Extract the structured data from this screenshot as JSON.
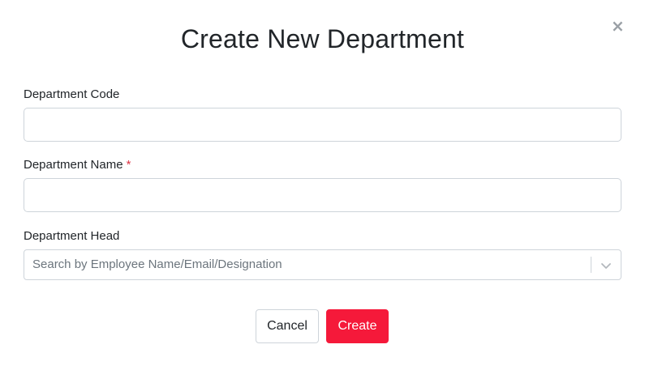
{
  "modal": {
    "title": "Create New Department",
    "close_icon": "close-icon",
    "close_symbol": "×"
  },
  "form": {
    "department_code": {
      "label": "Department Code",
      "value": "",
      "placeholder": ""
    },
    "department_name": {
      "label": "Department Name",
      "required_marker": "*",
      "value": "",
      "placeholder": ""
    },
    "department_head": {
      "label": "Department Head",
      "placeholder": "Search by Employee Name/Email/Designation",
      "icon": "chevron-down-icon"
    }
  },
  "actions": {
    "cancel_label": "Cancel",
    "create_label": "Create"
  },
  "colors": {
    "primary": "#f5193a",
    "required": "#dc3545",
    "border": "#ced4da",
    "placeholder": "#6c757d"
  }
}
